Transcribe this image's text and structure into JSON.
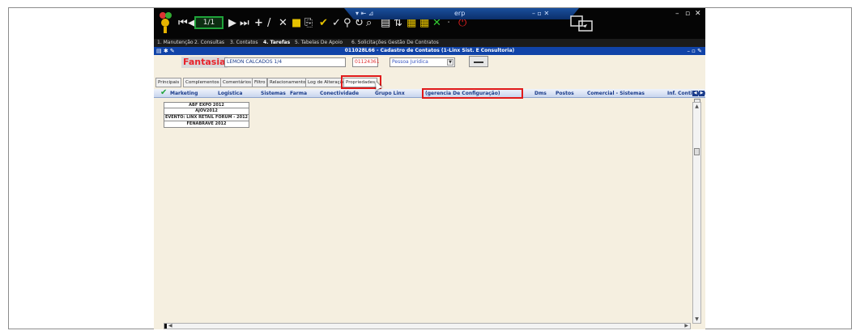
{
  "toolbar": {
    "pager": "1/1",
    "title_strip": "erp"
  },
  "menubar": {
    "items": [
      "1. Manutenção",
      "2. Consultas",
      "3. Contatos",
      "4. Tarefas",
      "5. Tabelas De Apoio",
      "6. Solicitações Gestão De Contratos"
    ]
  },
  "window": {
    "title": "011028L66 - Cadastro de Contatos (1-Linx Sist. E Consultoria)"
  },
  "form": {
    "fantasia_label": "Fantasia",
    "fantasia_value": "LEMON CALCADOS 1/4",
    "code_value": "01124361",
    "tipo_value": "Pessoa Juridica"
  },
  "tabs": [
    "Principais",
    "Complementos",
    "Comentários",
    "Filtro",
    "Relacionamentos",
    "Log de Alteração",
    "Propriedades"
  ],
  "categories": [
    "Marketing",
    "Logistica",
    "Sistemas",
    "Farma",
    "Conectividade",
    "Grupo Linx",
    "(gerencia De Configuração)",
    "Dms",
    "Postos",
    "Comercial - Sistemas",
    "Inf. Contingên"
  ],
  "properties": [
    "ABF EXPO 2012",
    "AJOV2012",
    "EVENTO: LINX RETAIL FORUM - 2012",
    "FENABRAVE 2012"
  ],
  "colors": {
    "highlight_box": "#e01a1a",
    "title_bar": "#1043a8",
    "fantasia_text": "#e8222a"
  }
}
